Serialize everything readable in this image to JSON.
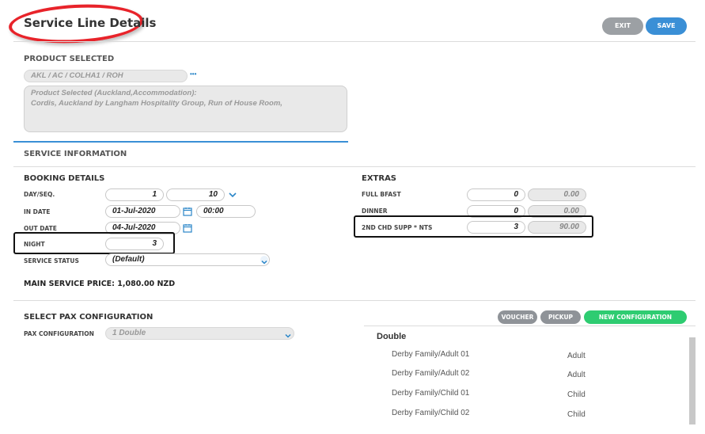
{
  "header": {
    "title": "Service Line Details",
    "exit_label": "EXIT",
    "save_label": "SAVE"
  },
  "product": {
    "section_label": "PRODUCT SELECTED",
    "code": "AKL / AC / COLHA1 / ROH",
    "more": "•••",
    "description_line1": "Product Selected (Auckland,Accommodation):",
    "description_line2": "Cordis, Auckland by Langham Hospitality Group, Run of House Room,"
  },
  "service_info": {
    "section_label": "SERVICE INFORMATION"
  },
  "booking": {
    "title": "BOOKING DETAILS",
    "day_seq_label": "DAY/SEQ.",
    "day": "1",
    "seq": "10",
    "in_date_label": "IN DATE",
    "in_date": "01-Jul-2020",
    "in_time": "00:00",
    "out_date_label": "OUT DATE",
    "out_date": "04-Jul-2020",
    "night_label": "NIGHT",
    "night": "3",
    "status_label": "SERVICE STATUS",
    "status": "(Default)"
  },
  "extras": {
    "title": "EXTRAS",
    "rows": [
      {
        "label": "FULL BFAST",
        "qty": "0",
        "amount": "0.00"
      },
      {
        "label": "DINNER",
        "qty": "0",
        "amount": "0.00"
      },
      {
        "label": "2ND CHD SUPP * NTS",
        "qty": "3",
        "amount": "90.00"
      }
    ]
  },
  "main_price": {
    "text": "MAIN SERVICE PRICE: 1,080.00 NZD"
  },
  "pax": {
    "title": "SELECT PAX CONFIGURATION",
    "config_label": "PAX CONFIGURATION",
    "config_value": "1 Double",
    "voucher_label": "VOUCHER",
    "pickup_label": "PICKUP",
    "new_config_label": "NEW CONFIGURATION",
    "group": "Double",
    "members": [
      {
        "name": "Derby Family/Adult 01",
        "type": "Adult"
      },
      {
        "name": "Derby Family/Adult 02",
        "type": "Adult"
      },
      {
        "name": "Derby Family/Child 01",
        "type": "Child"
      },
      {
        "name": "Derby Family/Child 02",
        "type": "Child"
      }
    ]
  },
  "colors": {
    "accent": "#3a8fd6",
    "green": "#2ecc71",
    "highlight": "#e8232a"
  }
}
